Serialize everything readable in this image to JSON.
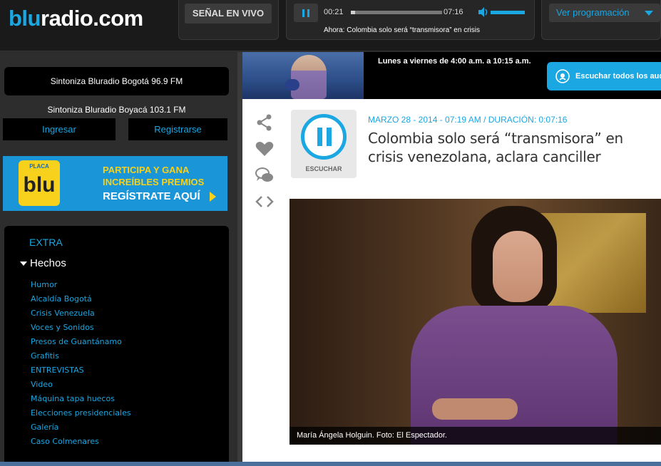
{
  "header": {
    "logo_prefix": "blu",
    "logo_suffix": "radio.com",
    "live_button": "SEÑAL EN VIVO",
    "player": {
      "current_time": "00:21",
      "total_time": "07:16",
      "progress_percent": 4.8,
      "now_playing": "Ahora: Colombia solo será “transmisora” en crisis"
    },
    "programming_select": "Ver programación"
  },
  "sidebar": {
    "station_primary": "Sintoniza Bluradio Bogotá 96.9 FM",
    "station_secondary": "Sintoniza Bluradio Boyacá 103.1 FM",
    "login_button": "Ingresar",
    "register_button": "Registrarse",
    "promo": {
      "plate_label": "PLACA",
      "plate_logo": "blu",
      "line1": "PARTICIPA Y GANA",
      "line2": "INCREÍBLES PREMIOS",
      "line3": "REGÍSTRATE AQUÍ"
    },
    "nav": {
      "extra": "EXTRA",
      "section": "Hechos",
      "items": [
        "Humor",
        "Alcaldía Bogotá",
        "Crisis Venezuela",
        "Voces y Sonidos",
        "Presos de Guantánamo",
        "Grafitis",
        "ENTREVISTAS",
        "Video",
        "Máquina tapa huecos",
        "Elecciones presidenciales",
        "Galería",
        "Caso Colmenares"
      ]
    }
  },
  "main": {
    "hero": {
      "schedule": "Lunes a viernes de 4:00 a.m. a 10:15 a.m.",
      "listen_all": "Escuchar todos los aud"
    },
    "article": {
      "listen_label": "ESCUCHAR",
      "meta": "MARZO 28 - 2014 - 07:19 AM / DURACIÓN: 0:07:16",
      "headline": "Colombia solo será “transmisora” en crisis venezolana, aclara canciller",
      "caption": "María Ángela Holguin. Foto: El Espectador."
    }
  },
  "colors": {
    "accent": "#1aa7e2",
    "header_bg": "#1a1a1a",
    "sidebar_bg": "#2d2d2d",
    "promo_yellow": "#f7d11c"
  },
  "icons": [
    "pause-icon",
    "volume-icon",
    "chevron-down-icon",
    "share-icon",
    "heart-icon",
    "comment-icon",
    "embed-code-icon",
    "podcast-icon"
  ]
}
